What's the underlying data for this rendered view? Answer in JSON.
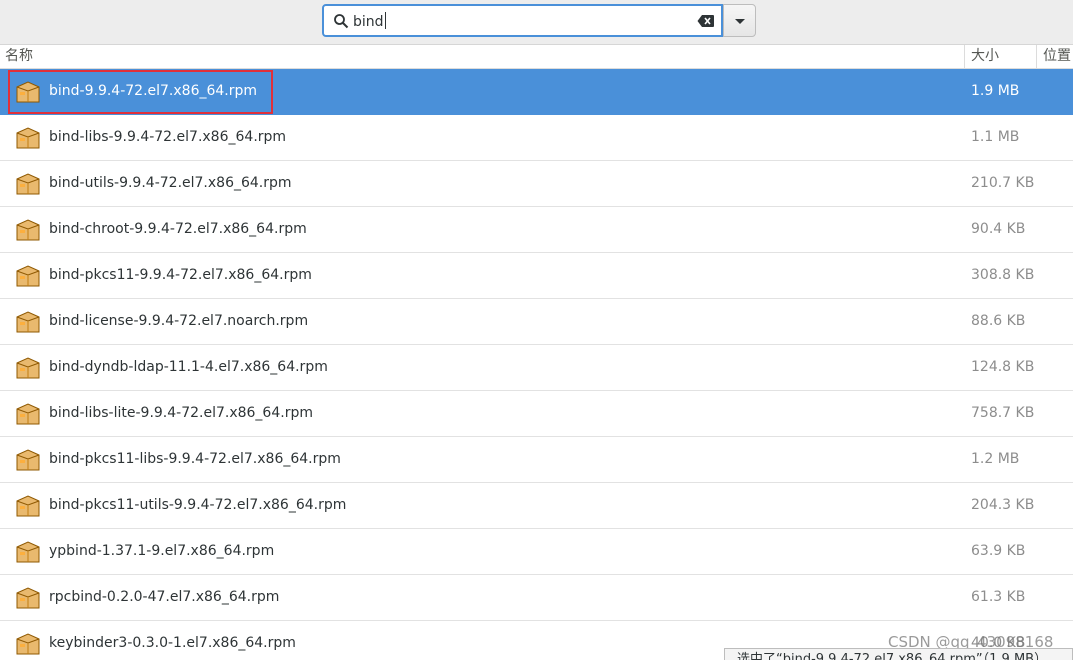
{
  "search": {
    "value": "bind",
    "icon": "search-icon",
    "clear_icon": "clear-text-icon",
    "dropdown_icon": "chevron-down-icon"
  },
  "columns": {
    "name": "名称",
    "size": "大小",
    "location": "位置"
  },
  "files": [
    {
      "name": "bind-9.9.4-72.el7.x86_64.rpm",
      "size": "1.9 MB",
      "selected": true
    },
    {
      "name": "bind-libs-9.9.4-72.el7.x86_64.rpm",
      "size": "1.1 MB"
    },
    {
      "name": "bind-utils-9.9.4-72.el7.x86_64.rpm",
      "size": "210.7 KB"
    },
    {
      "name": "bind-chroot-9.9.4-72.el7.x86_64.rpm",
      "size": "90.4 KB"
    },
    {
      "name": "bind-pkcs11-9.9.4-72.el7.x86_64.rpm",
      "size": "308.8 KB"
    },
    {
      "name": "bind-license-9.9.4-72.el7.noarch.rpm",
      "size": "88.6 KB"
    },
    {
      "name": "bind-dyndb-ldap-11.1-4.el7.x86_64.rpm",
      "size": "124.8 KB"
    },
    {
      "name": "bind-libs-lite-9.9.4-72.el7.x86_64.rpm",
      "size": "758.7 KB"
    },
    {
      "name": "bind-pkcs11-libs-9.9.4-72.el7.x86_64.rpm",
      "size": "1.2 MB"
    },
    {
      "name": "bind-pkcs11-utils-9.9.4-72.el7.x86_64.rpm",
      "size": "204.3 KB"
    },
    {
      "name": "ypbind-1.37.1-9.el7.x86_64.rpm",
      "size": "63.9 KB"
    },
    {
      "name": "rpcbind-0.2.0-47.el7.x86_64.rpm",
      "size": "61.3 KB"
    },
    {
      "name": "keybinder3-0.3.0-1.el7.x86_64.rpm",
      "size": "40.0 KB"
    }
  ],
  "file_icon": "package-icon",
  "status": {
    "text": "选中了“bind-9.9.4-72.el7.x86_64.rpm”（1.9 MB）"
  },
  "watermark": "CSDN @qq_43098168",
  "colors": {
    "selection": "#4a90d9",
    "focus_ring": "#4a90d9",
    "annotation_box": "#e0303a"
  }
}
